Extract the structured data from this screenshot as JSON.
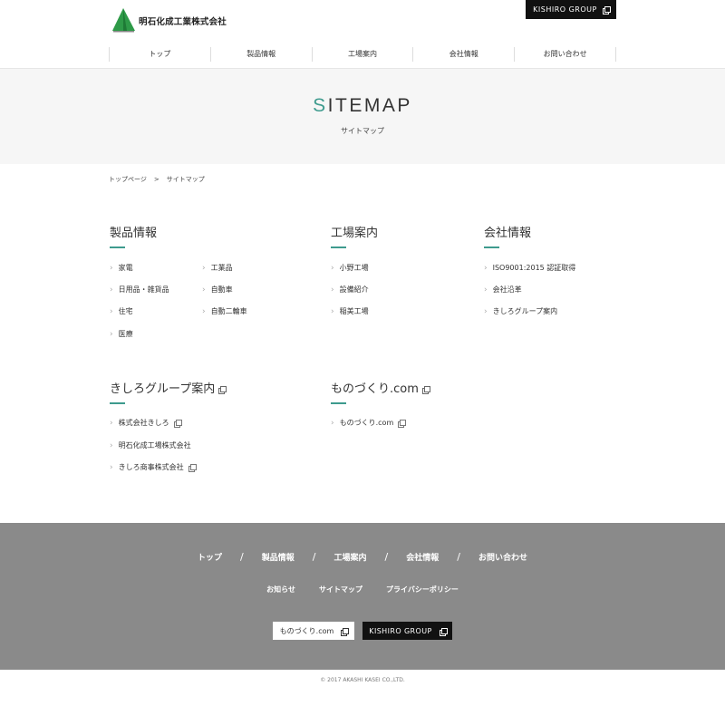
{
  "header": {
    "logo_text": "明石化成工業株式会社",
    "group_button": "KISHIRO GROUP",
    "nav": [
      "トップ",
      "製品情報",
      "工場案内",
      "会社情報",
      "お問い合わせ"
    ],
    "brand_color": "#3e9b8e"
  },
  "hero": {
    "title_first": "S",
    "title_rest": "ITEMAP",
    "subtitle": "サイトマップ"
  },
  "breadcrumb": {
    "home": "トップページ",
    "separator": ">",
    "current": "サイトマップ"
  },
  "sections": {
    "products": {
      "title": "製品情報",
      "links": [
        "家電",
        "工業品",
        "日用品・雑貨品",
        "自動車",
        "住宅",
        "自動二輪車",
        "医療"
      ]
    },
    "factory": {
      "title": "工場案内",
      "links": [
        "小野工場",
        "設備紹介",
        "稲美工場"
      ]
    },
    "company": {
      "title": "会社情報",
      "links": [
        "ISO9001:2015 認証取得",
        "会社沿革",
        "きしろグループ案内"
      ]
    },
    "group": {
      "title": "きしろグループ案内",
      "links": [
        "株式会社きしろ",
        "明石化成工場株式会社",
        "きしろ商事株式会社"
      ]
    },
    "monozukuri": {
      "title": "ものづくり.com",
      "links": [
        "ものづくり.com"
      ]
    }
  },
  "footer": {
    "nav": [
      "トップ",
      "製品情報",
      "工場案内",
      "会社情報",
      "お問い合わせ"
    ],
    "separator": "/",
    "subnav": [
      "お知らせ",
      "サイトマップ",
      "プライバシーポリシー"
    ],
    "btn_monozukuri": "ものづくり.com",
    "btn_group": "KISHIRO GROUP",
    "copyright": "© 2017 AKASHI KASEI CO.,LTD."
  }
}
